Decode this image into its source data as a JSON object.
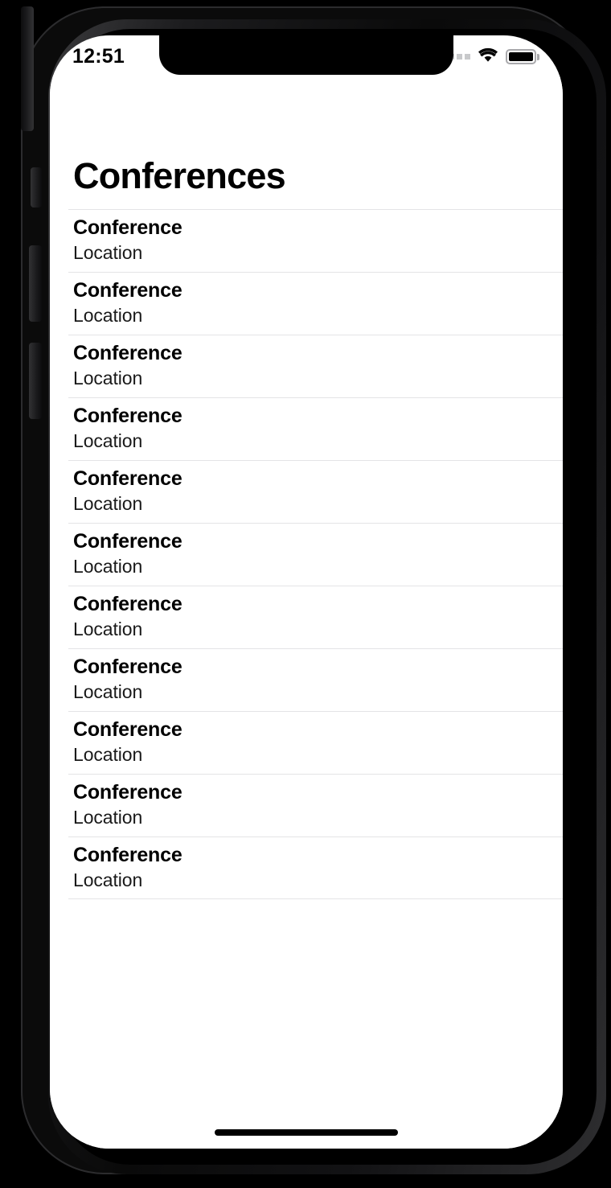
{
  "device": {
    "name": "iphone-simulator",
    "buttons": [
      "ringer-switch",
      "volume-down-button",
      "volume-up-button",
      "power-button"
    ]
  },
  "status_bar": {
    "time": "12:51",
    "signal_icon": "signal-dots-icon",
    "wifi_icon": "wifi-icon",
    "battery_icon": "battery-full-icon",
    "battery_level": 100,
    "signal_dot_count": 4
  },
  "screen": {
    "title": "Conferences",
    "background_color": "#ffffff",
    "separator_color": "#e4e4e6",
    "text_color": "#000000"
  },
  "list": {
    "rows": [
      {
        "title": "Conference",
        "subtitle": "Location"
      },
      {
        "title": "Conference",
        "subtitle": "Location"
      },
      {
        "title": "Conference",
        "subtitle": "Location"
      },
      {
        "title": "Conference",
        "subtitle": "Location"
      },
      {
        "title": "Conference",
        "subtitle": "Location"
      },
      {
        "title": "Conference",
        "subtitle": "Location"
      },
      {
        "title": "Conference",
        "subtitle": "Location"
      },
      {
        "title": "Conference",
        "subtitle": "Location"
      },
      {
        "title": "Conference",
        "subtitle": "Location"
      },
      {
        "title": "Conference",
        "subtitle": "Location"
      },
      {
        "title": "Conference",
        "subtitle": "Location"
      }
    ]
  },
  "home_indicator": {
    "name": "home-indicator"
  }
}
